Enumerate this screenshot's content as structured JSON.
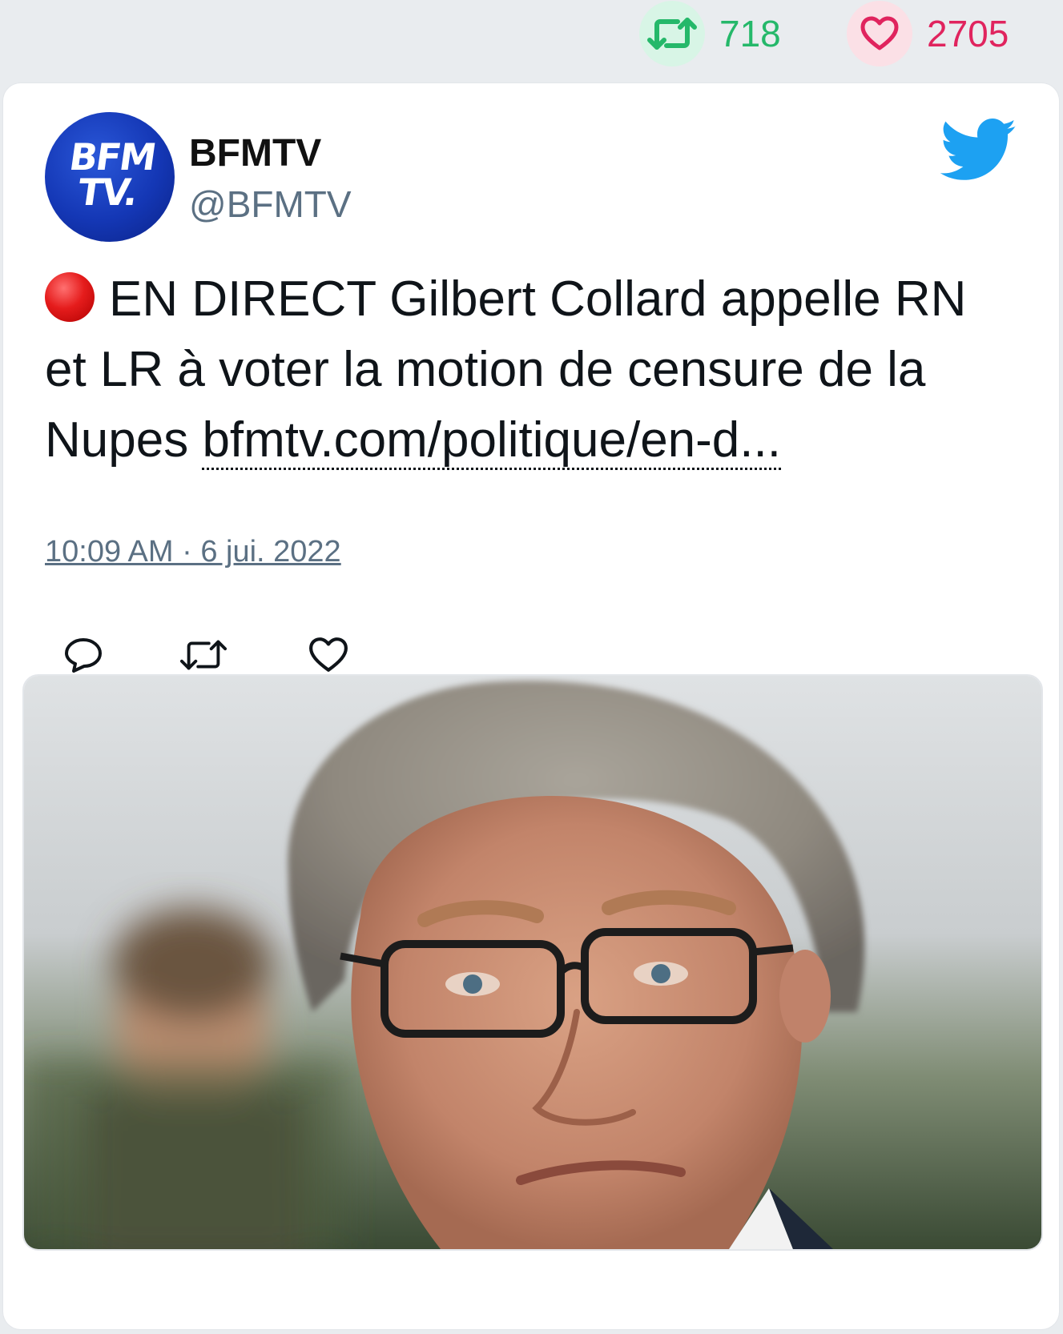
{
  "stats": {
    "retweets": "718",
    "likes": "2705",
    "retweet_icon": "retweet-icon",
    "like_icon": "heart-icon",
    "retweet_color": "#25b86a",
    "like_color": "#e0245e"
  },
  "tweet": {
    "avatar_text_line1": "BFM",
    "avatar_text_line2": "TV.",
    "name": "BFMTV",
    "handle": "@BFMTV",
    "text_main": "EN DIRECT Gilbert Collard appelle RN et LR à voter la motion de censure de la Nupes",
    "link": "bfmtv.com/politique/en-d...",
    "timestamp": "10:09 AM · 6 jui. 2022",
    "brand_icon": "twitter-bird-icon",
    "live_icon": "red-circle-icon"
  },
  "actions": {
    "reply_icon": "reply-icon",
    "retweet_icon": "retweet-icon",
    "like_icon": "heart-icon"
  },
  "media": {
    "image": "photo of a man with grey hair and glasses"
  }
}
